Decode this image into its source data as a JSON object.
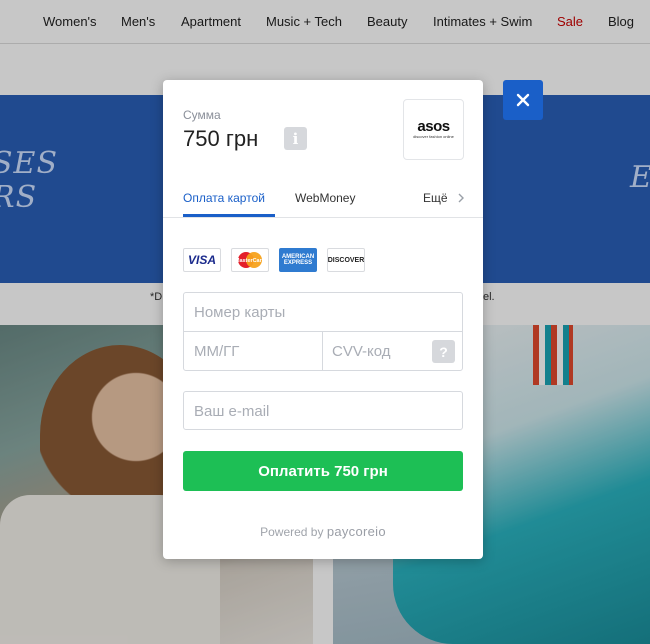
{
  "nav": {
    "items": [
      "Women's",
      "Men's",
      "Apartment",
      "Music + Tech",
      "Beauty",
      "Intimates + Swim",
      "Sale",
      "Blog"
    ]
  },
  "banner": {
    "left_text": "SES\nRS",
    "right_text": "EN"
  },
  "disclaimer": {
    "left": "*D",
    "right": "el."
  },
  "modal": {
    "amount_label": "Сумма",
    "amount_value": "750 грн",
    "info_icon": "i",
    "merchant": {
      "name": "asos",
      "tagline": "discover fashion online"
    },
    "tabs": [
      {
        "label": "Оплата картой",
        "active": true
      },
      {
        "label": "WebMoney",
        "active": false
      }
    ],
    "more_label": "Ещё",
    "card_logos": {
      "visa": "VISA",
      "mastercard": "MasterCard",
      "amex": "AMERICAN EXPRESS",
      "discover": "DISCOVER"
    },
    "card_number_placeholder": "Номер карты",
    "expiry_placeholder": "ММ/ГГ",
    "cvv_placeholder": "CVV-код",
    "cvv_help": "?",
    "email_placeholder": "Ваш e-mail",
    "pay_button": "Оплатить 750 грн",
    "powered_by": "Powered by",
    "powered_brand": "paycoreio"
  },
  "colors": {
    "accent": "#1a5fc8",
    "pay": "#1dbf55",
    "sale": "#cc0000"
  }
}
